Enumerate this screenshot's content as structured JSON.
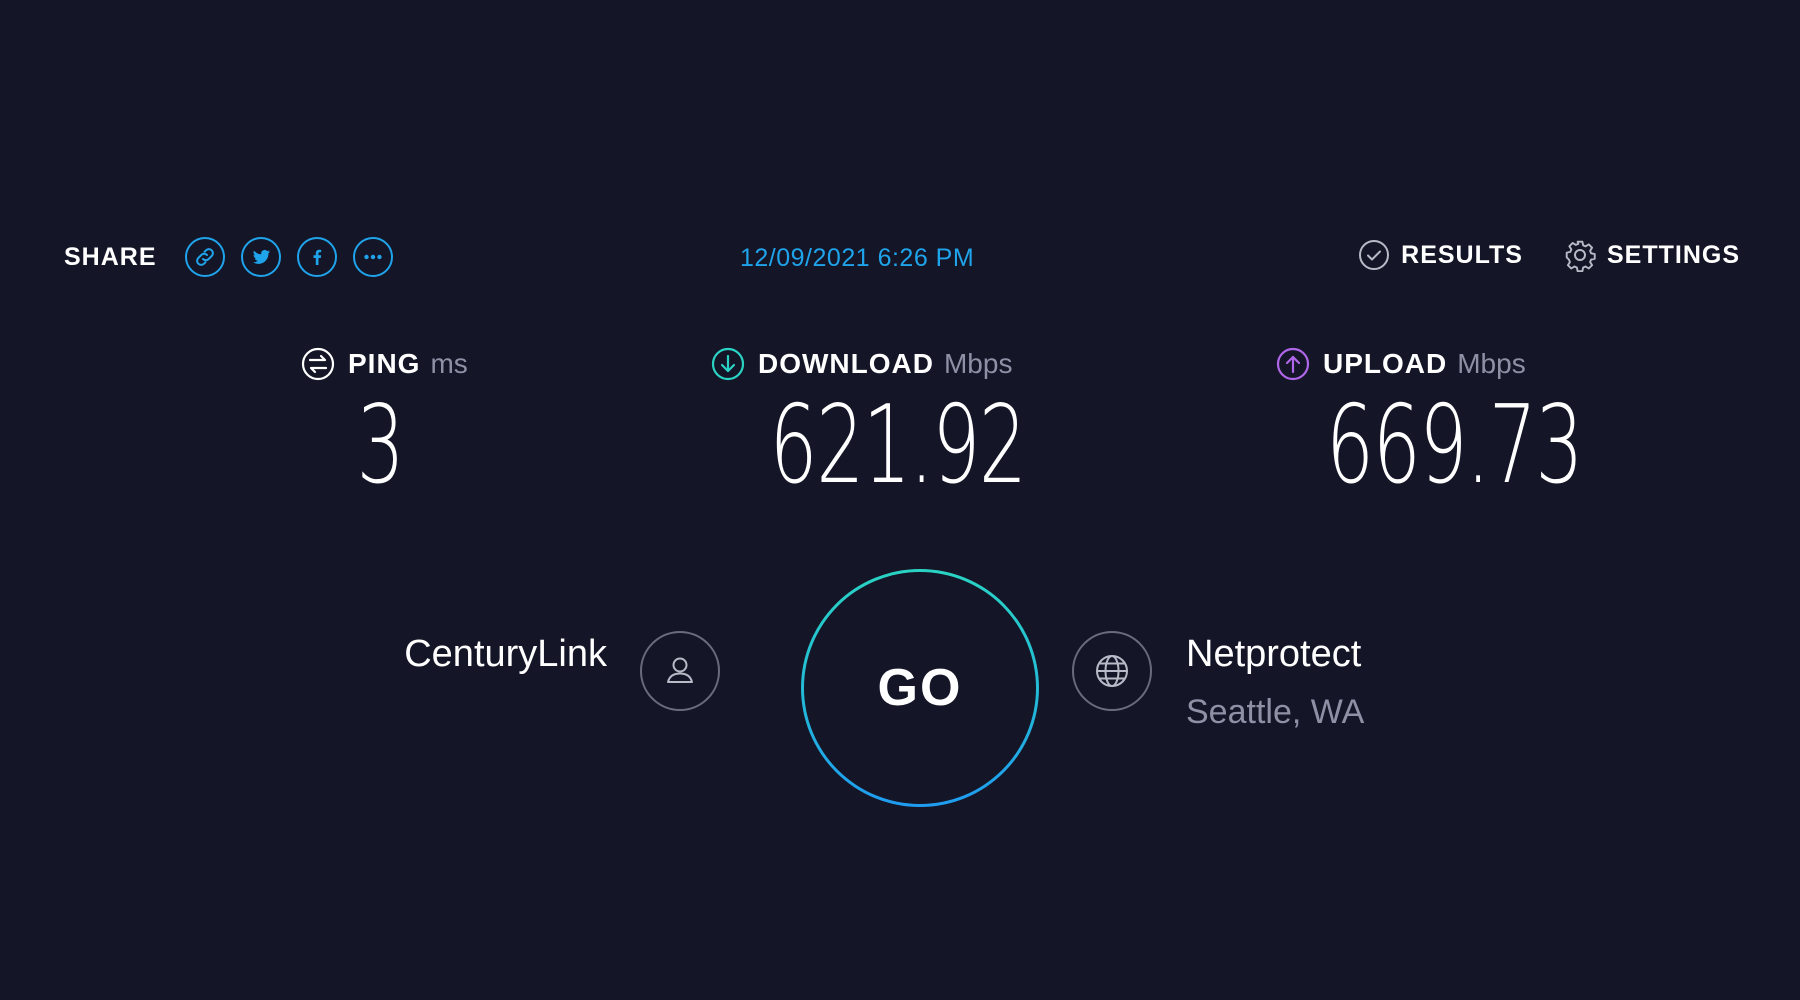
{
  "share": {
    "label": "SHARE",
    "buttons": [
      "link-icon",
      "twitter-icon",
      "facebook-icon",
      "more-icon"
    ]
  },
  "timestamp": "12/09/2021 6:26 PM",
  "nav": {
    "results": "RESULTS",
    "settings": "SETTINGS"
  },
  "metrics": {
    "ping": {
      "label": "PING",
      "unit": "ms",
      "value": "3",
      "icon": "ping-icon"
    },
    "download": {
      "label": "DOWNLOAD",
      "unit": "Mbps",
      "value": "621.92",
      "icon": "download-icon"
    },
    "upload": {
      "label": "UPLOAD",
      "unit": "Mbps",
      "value": "669.73",
      "icon": "upload-icon"
    }
  },
  "isp": {
    "name": "CenturyLink",
    "icon": "user-icon"
  },
  "go_button": {
    "label": "GO"
  },
  "server": {
    "name": "Netprotect",
    "location": "Seattle, WA",
    "icon": "globe-icon"
  },
  "colors": {
    "background": "#141526",
    "accent": "#1fa3ea",
    "download": "#2ad3c3",
    "upload": "#b066e8",
    "muted": "#8f90a6"
  }
}
